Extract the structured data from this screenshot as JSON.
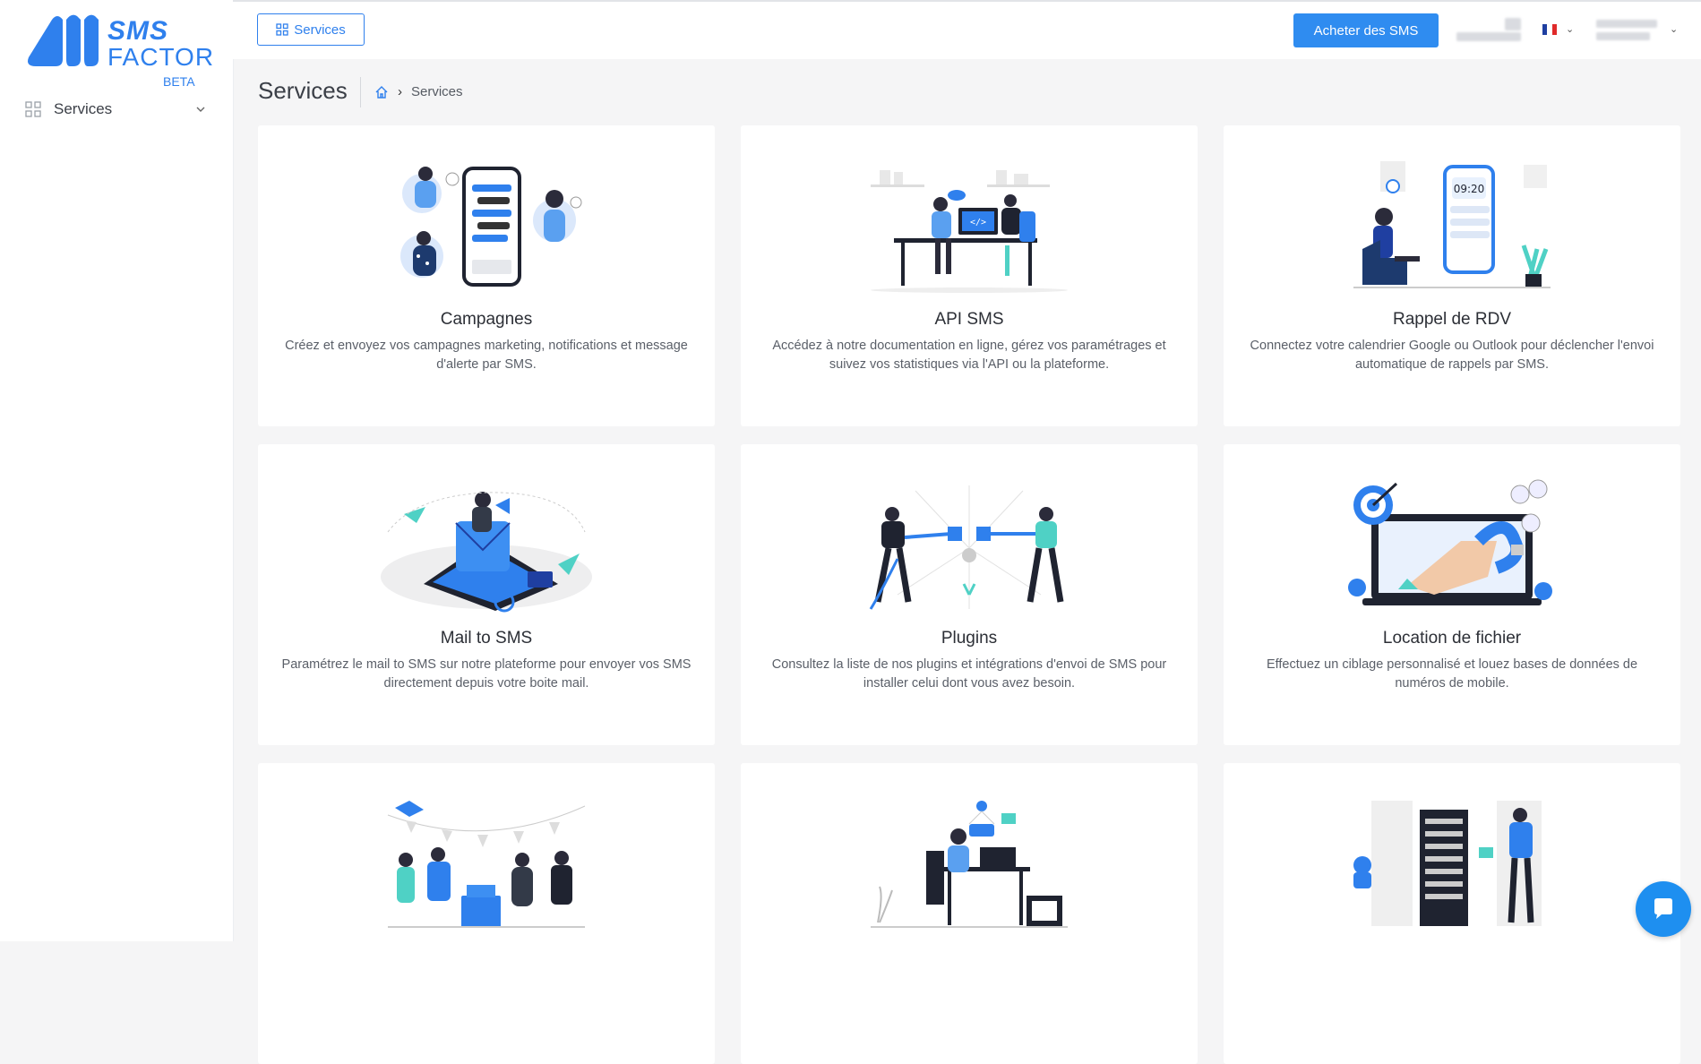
{
  "brand": {
    "logo_line1": "SMS",
    "logo_line2": "FACTOR",
    "logo_badge": "BETA",
    "accent_color": "#2f80ed"
  },
  "sidebar": {
    "items": [
      {
        "label": "Services",
        "icon": "grid-icon",
        "expandable": true
      }
    ]
  },
  "topbar": {
    "services_button": "Services",
    "buy_button": "Acheter des SMS",
    "language_flag": "fr"
  },
  "page": {
    "title": "Services",
    "breadcrumb": {
      "current": "Services"
    }
  },
  "cards": [
    {
      "title": "Campagnes",
      "description": "Créez et envoyez vos campagnes marketing, notifications et message d'alerte par SMS."
    },
    {
      "title": "API SMS",
      "description": "Accédez à notre documentation en ligne, gérez vos paramétrages et suivez vos statistiques via l'API ou la plateforme."
    },
    {
      "title": "Rappel de RDV",
      "description": "Connectez votre calendrier Google ou Outlook pour déclencher l'envoi automatique de rappels par SMS.",
      "illustration_time": "09:20"
    },
    {
      "title": "Mail to SMS",
      "description": "Paramétrez le mail to SMS sur notre plateforme pour envoyer vos SMS directement depuis votre boite mail."
    },
    {
      "title": "Plugins",
      "description": "Consultez la liste de nos plugins et intégrations d'envoi de SMS pour installer celui dont vous avez besoin."
    },
    {
      "title": "Location de fichier",
      "description": "Effectuez un ciblage personnalisé et louez bases de données de numéros de mobile."
    },
    {
      "title": "",
      "description": ""
    },
    {
      "title": "",
      "description": ""
    },
    {
      "title": "",
      "description": ""
    }
  ]
}
